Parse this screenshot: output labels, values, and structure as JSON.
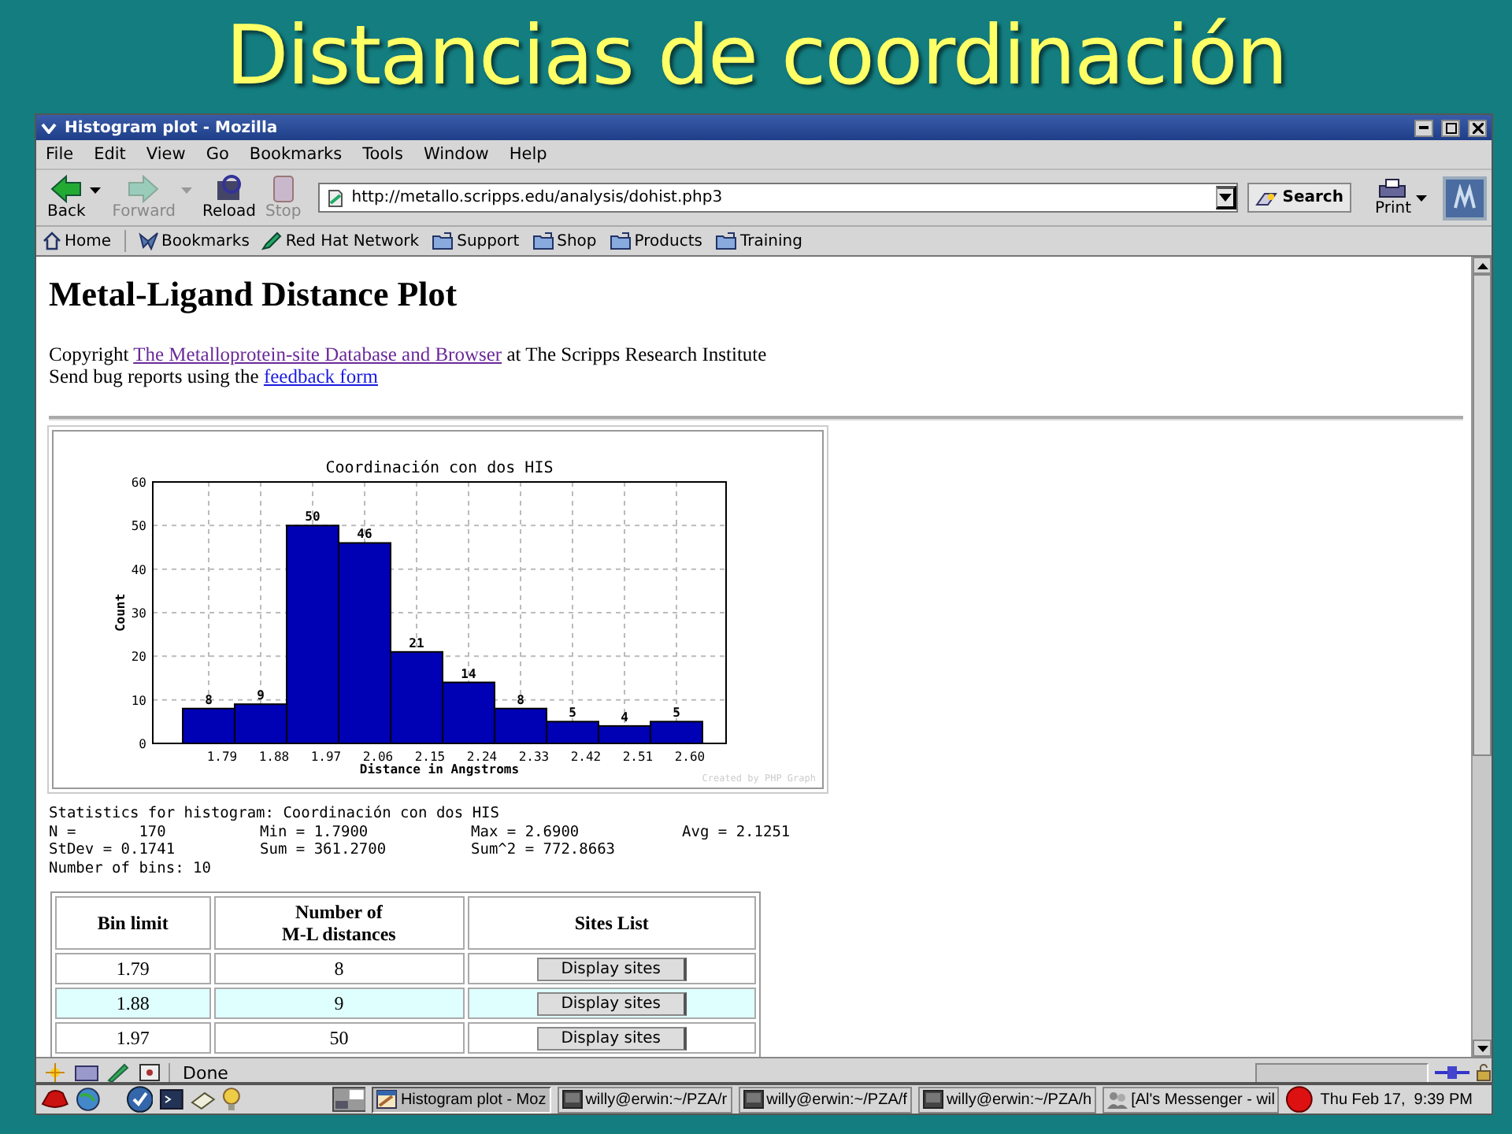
{
  "slide_title": "Distancias de coordinación",
  "window": {
    "title": "Histogram plot - Mozilla"
  },
  "menu": [
    "File",
    "Edit",
    "View",
    "Go",
    "Bookmarks",
    "Tools",
    "Window",
    "Help"
  ],
  "toolbar": {
    "buttons": [
      {
        "kind": "back",
        "label": "Back",
        "disabled": false
      },
      {
        "kind": "forward",
        "label": "Forward",
        "disabled": true
      },
      {
        "kind": "reload",
        "label": "Reload",
        "disabled": false
      },
      {
        "kind": "stop",
        "label": "Stop",
        "disabled": true
      }
    ],
    "url": "http://metallo.scripps.edu/analysis/dohist.php3",
    "search": "Search",
    "print": "Print"
  },
  "personal_bar": [
    {
      "kind": "home",
      "label": "Home"
    },
    {
      "kind": "bookmarks",
      "label": "Bookmarks"
    },
    {
      "kind": "redhat",
      "label": "Red Hat Network"
    },
    {
      "kind": "folder",
      "label": "Support"
    },
    {
      "kind": "folder",
      "label": "Shop"
    },
    {
      "kind": "folder",
      "label": "Products"
    },
    {
      "kind": "folder",
      "label": "Training"
    }
  ],
  "page": {
    "heading": "Metal-Ligand Distance Plot",
    "copyright": {
      "before": "Copyright",
      "link": "The Metalloprotein-site Database and Browser",
      "visited": true,
      "after": "at The Scripps Research Institute"
    },
    "bug_report": {
      "before": "Send bug reports using the",
      "link": "feedback form",
      "visited": false
    },
    "chart": {
      "chart_data": {
        "type": "bar",
        "title": "Coordinación con dos HIS",
        "xlabel": "Distance in Angstroms",
        "ylabel": "Count",
        "categories": [
          "1.79",
          "1.88",
          "1.97",
          "2.06",
          "2.15",
          "2.24",
          "2.33",
          "2.42",
          "2.51",
          "2.60"
        ],
        "values": [
          8,
          9,
          50,
          46,
          21,
          14,
          8,
          5,
          4,
          5
        ],
        "ylim": [
          0,
          60
        ],
        "yticks": [
          0,
          10,
          20,
          30,
          40,
          50,
          60
        ],
        "data_labels": true,
        "grid": true
      },
      "credit": "Created by PHP Graph"
    },
    "statistics": {
      "heading": "Statistics for histogram: Coordinación con dos HIS",
      "rows": [
        [
          "N =       170",
          "Min = 1.7900",
          "Max = 2.6900",
          "Avg = 2.1251"
        ],
        [
          "StDev = 0.1741",
          "Sum = 361.2700",
          "Sum^2 = 772.8663"
        ]
      ],
      "bins": "Number of bins: 10"
    },
    "table": {
      "columns": [
        [
          "Bin limit"
        ],
        [
          "Number of",
          "M-L distances"
        ],
        [
          "Sites List"
        ]
      ],
      "rows": [
        {
          "bin_limit": "1.79",
          "count": "8",
          "action": "Display sites"
        },
        {
          "bin_limit": "1.88",
          "count": "9",
          "action": "Display sites"
        },
        {
          "bin_limit": "1.97",
          "count": "50",
          "action": "Display sites"
        }
      ]
    }
  },
  "status_bar": {
    "text": "Done"
  },
  "taskbar": {
    "items": [
      {
        "kind": "browser",
        "label": "Histogram plot - Moz",
        "selected": true
      },
      {
        "kind": "terminal",
        "label": "willy@erwin:~/PZA/r",
        "selected": false
      },
      {
        "kind": "terminal",
        "label": "willy@erwin:~/PZA/f",
        "selected": false
      },
      {
        "kind": "terminal",
        "label": "willy@erwin:~/PZA/h",
        "selected": false
      },
      {
        "kind": "messenger",
        "label": "[Al's Messenger - wil",
        "selected": false
      }
    ],
    "clock": "Thu Feb 17,  9:39 PM"
  }
}
